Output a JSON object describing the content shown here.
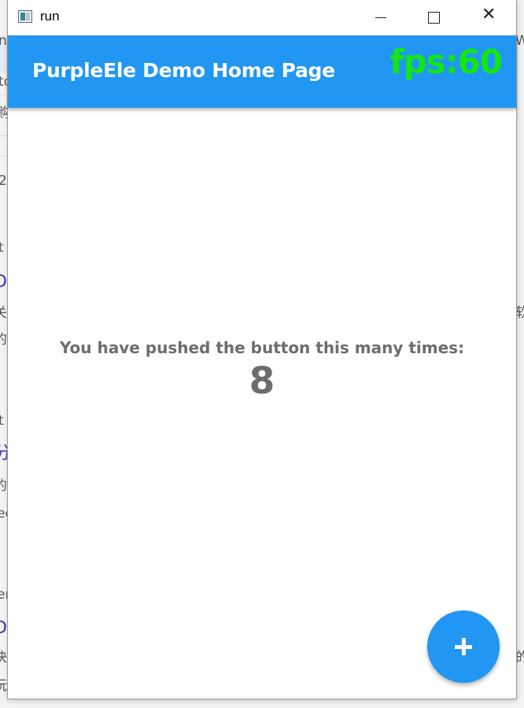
{
  "background_page": {
    "fragments": [
      "n/",
      "to",
      "购",
      "2",
      "t",
      "D",
      "关",
      "的",
      "t",
      "分",
      "的",
      "ec",
      "er",
      "D",
      "块",
      "玩",
      "W",
      "软",
      "的"
    ]
  },
  "window": {
    "title": "run",
    "icon": "app-window-icon",
    "controls": {
      "minimize": "minimize-icon",
      "maximize": "maximize-icon",
      "close_glyph": "✕"
    }
  },
  "appbar": {
    "title": "PurpleEle Demo Home Page",
    "fps": "fps:60",
    "background_color": "#2196f3",
    "fps_color": "#13e613"
  },
  "body": {
    "counter_label": "You have pushed the button this many times:",
    "counter_value": "8",
    "text_color": "#6d6d6d"
  },
  "fab": {
    "icon": "plus-icon",
    "color": "#2196f3"
  }
}
